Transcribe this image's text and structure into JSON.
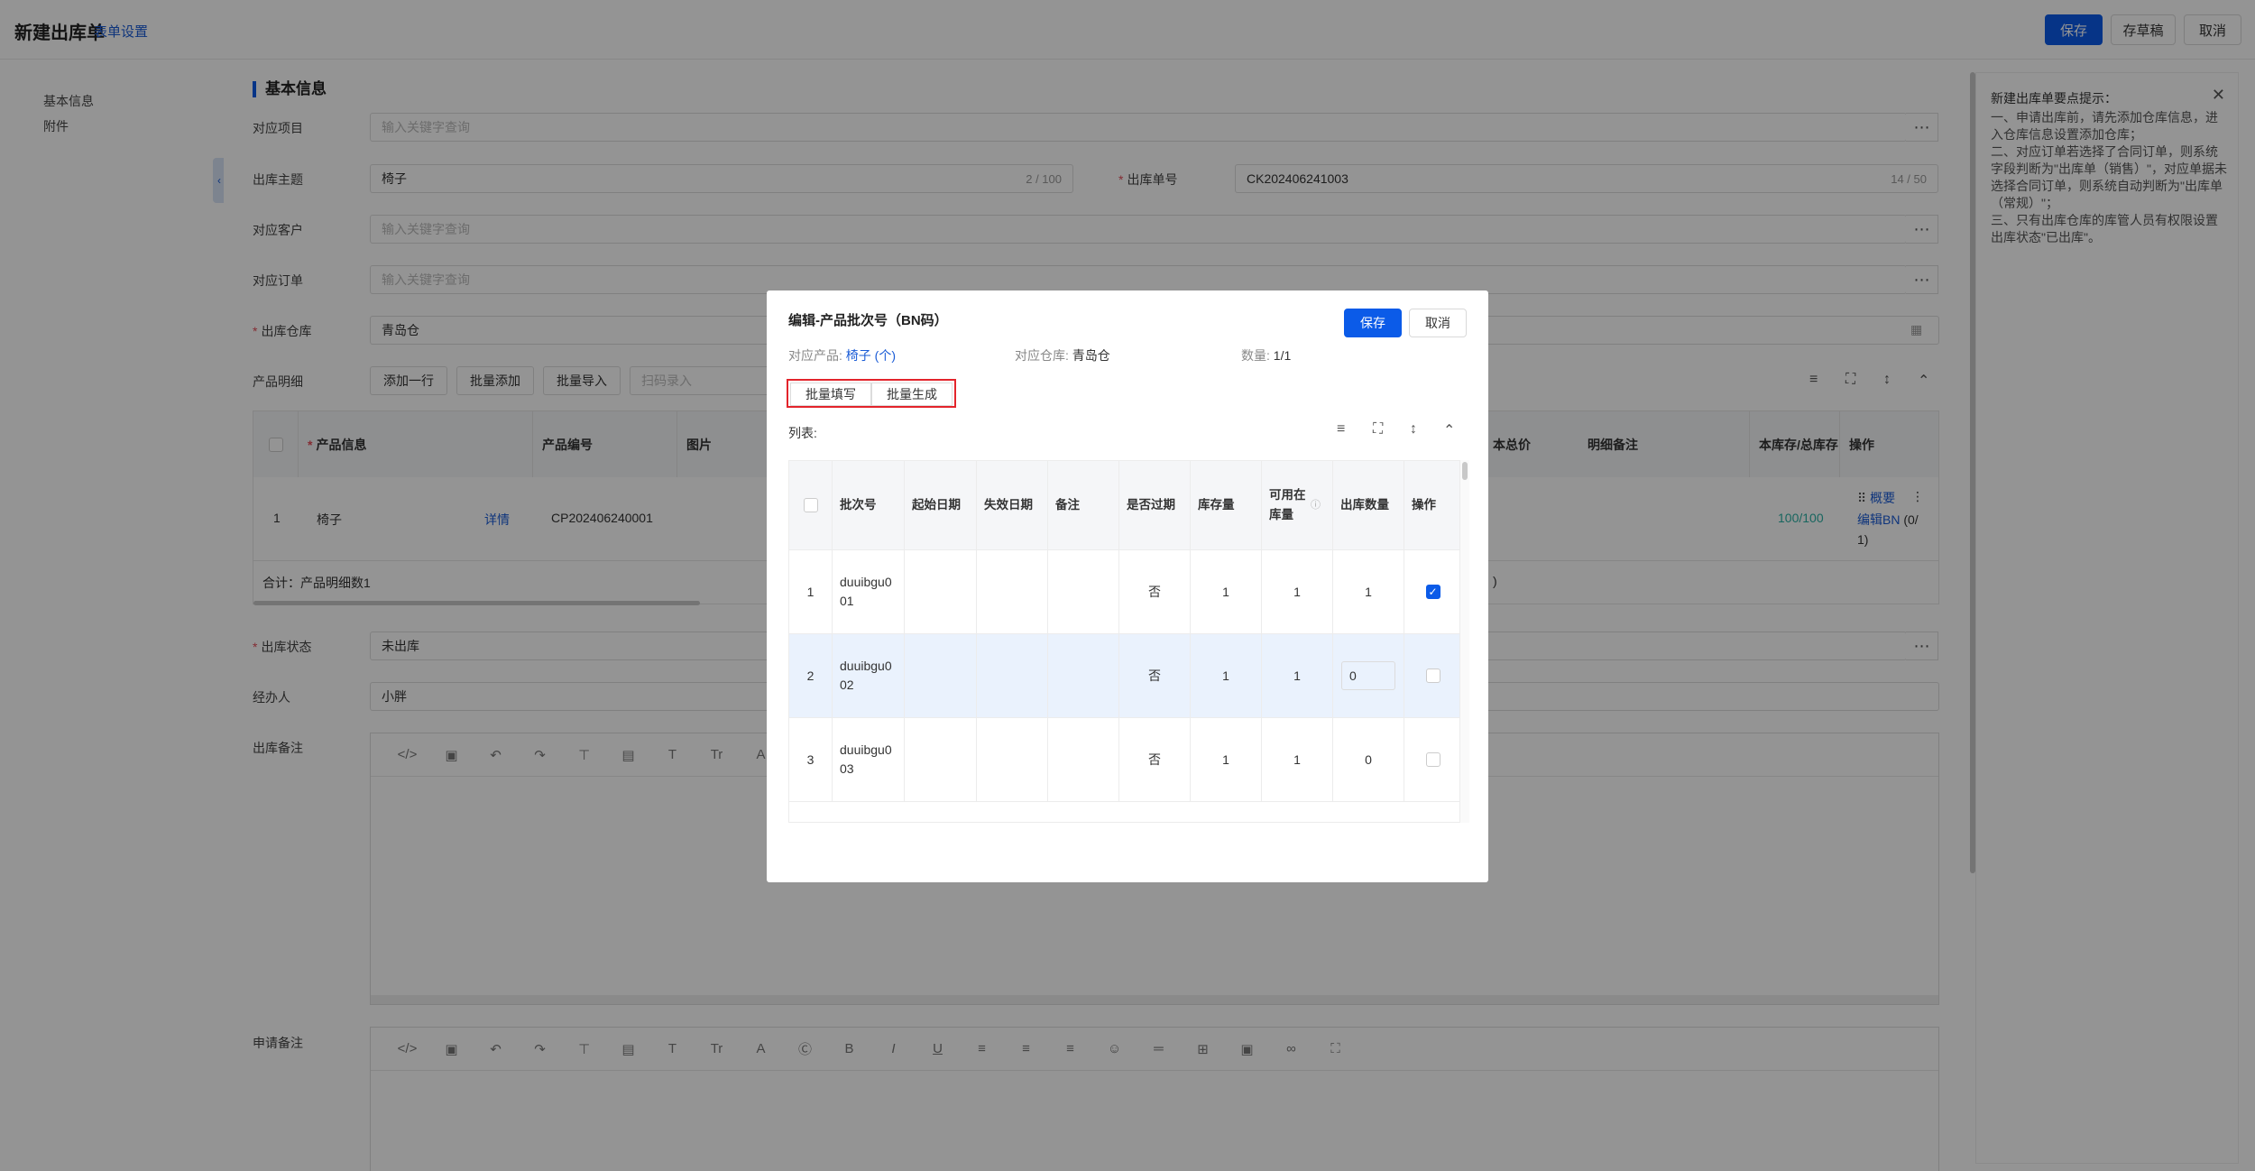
{
  "header": {
    "title": "新建出库单",
    "form_settings": "表单设置",
    "save": "保存",
    "save_draft": "存草稿",
    "cancel": "取消"
  },
  "nav": {
    "items": [
      "基本信息",
      "附件"
    ]
  },
  "section": {
    "basic_info": "基本信息"
  },
  "form": {
    "project_label": "对应项目",
    "project_placeholder": "输入关键字查询",
    "subject_label": "出库主题",
    "subject_value": "椅子",
    "subject_count": "2 / 100",
    "order_no_label": "出库单号",
    "order_no_value": "CK202406241003",
    "order_no_count": "14 / 50",
    "customer_label": "对应客户",
    "customer_placeholder": "输入关键字查询",
    "sales_order_label": "对应订单",
    "sales_order_placeholder": "输入关键字查询",
    "warehouse_label": "出库仓库",
    "warehouse_value": "青岛仓",
    "detail_label": "产品明细",
    "add_row": "添加一行",
    "batch_add": "批量添加",
    "batch_import": "批量导入",
    "scan_placeholder": "扫码录入",
    "status_label": "出库状态",
    "status_value": "未出库",
    "handler_label": "经办人",
    "handler_value": "小胖",
    "remark_label": "出库备注",
    "apply_remark_label": "申请备注"
  },
  "main_table": {
    "headers": [
      "产品信息",
      "产品编号",
      "图片",
      "本总价",
      "明细备注",
      "本库存/总库存",
      "操作"
    ],
    "row": {
      "index": "1",
      "product": "椅子",
      "detail_link": "详情",
      "code": "CP202406240001",
      "stock": "100",
      "total_stock": "100",
      "op_summary": "概要",
      "op_edit_bn": "编辑BN",
      "op_bn_count": "(0/",
      "op_bn_count2": "1)",
      "partial": ")"
    },
    "summary": "合计：产品明细数1"
  },
  "tips": {
    "title": "新建出库单要点提示：",
    "text": "一、申请出库前，请先添加仓库信息，进入仓库信息设置添加仓库；\n二、对应订单若选择了合同订单，则系统字段判断为\"出库单（销售）\"，对应单据未选择合同订单，则系统自动判断为\"出库单（常规）\"；\n三、只有出库仓库的库管人员有权限设置出库状态\"已出库\"。"
  },
  "modal": {
    "title": "编辑-产品批次号（BN码）",
    "save": "保存",
    "cancel": "取消",
    "product_label": "对应产品:",
    "product_value": "椅子 (个)",
    "warehouse_label": "对应仓库:",
    "warehouse_value": "青岛仓",
    "qty_label": "数量:",
    "qty_value": "1/1",
    "batch_fill": "批量填写",
    "batch_generate": "批量生成",
    "list_label": "列表:",
    "columns": [
      "批次号",
      "起始日期",
      "失效日期",
      "备注",
      "是否过期",
      "库存量",
      "可用在库量",
      "出库数量",
      "操作"
    ],
    "rows": [
      {
        "idx": "1",
        "bn": "duuibgu001",
        "expired": "否",
        "stock": "1",
        "available": "1",
        "out": "1",
        "checked": true
      },
      {
        "idx": "2",
        "bn": "duuibgu002",
        "expired": "否",
        "stock": "1",
        "available": "1",
        "out": "0",
        "checked": false
      },
      {
        "idx": "3",
        "bn": "duuibgu003",
        "expired": "否",
        "stock": "1",
        "available": "1",
        "out": "0",
        "checked": false
      }
    ]
  },
  "colors": {
    "primary": "#0b5be8",
    "link": "#1a5cd6",
    "highlight_border": "#e3242b",
    "required": "#e34d59"
  }
}
